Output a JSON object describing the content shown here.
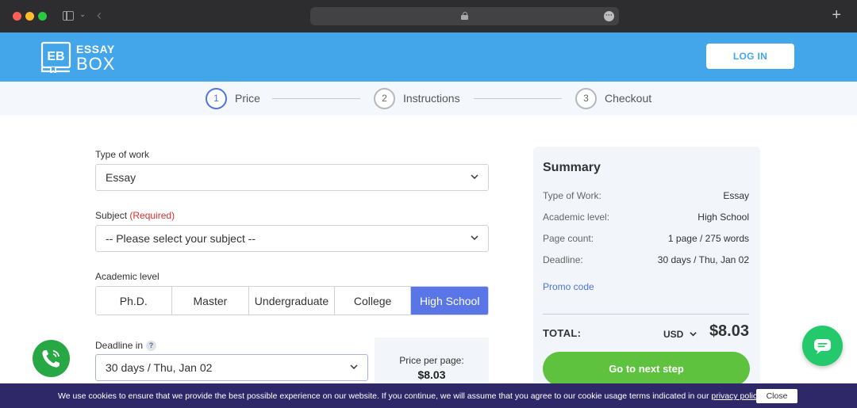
{
  "brand": {
    "logo_initials": "EB",
    "line1": "ESSAY",
    "line2": "BOX",
    "color": "#43a6ea"
  },
  "header": {
    "login_label": "LOG IN"
  },
  "stepper": [
    {
      "number": "1",
      "label": "Price",
      "active": true
    },
    {
      "number": "2",
      "label": "Instructions",
      "active": false
    },
    {
      "number": "3",
      "label": "Checkout",
      "active": false
    }
  ],
  "form": {
    "type_of_work": {
      "label": "Type of work",
      "value": "Essay"
    },
    "subject": {
      "label": "Subject",
      "required": "(Required)",
      "value": "-- Please select your subject --"
    },
    "academic_level": {
      "label": "Academic level",
      "options": [
        "Ph.D.",
        "Master",
        "Undergraduate",
        "College",
        "High School"
      ],
      "selected": "High School"
    },
    "deadline": {
      "label": "Deadline in",
      "help": "?",
      "value": "30 days / Thu, Jan 02"
    },
    "price_per_page": {
      "label": "Price per page:",
      "value": "$8.03"
    }
  },
  "summary": {
    "title": "Summary",
    "rows": [
      {
        "key": "Type of Work:",
        "value": "Essay"
      },
      {
        "key": "Academic level:",
        "value": "High School"
      },
      {
        "key": "Page count:",
        "value": "1 page / 275 words"
      },
      {
        "key": "Deadline:",
        "value": "30 days / Thu, Jan 02"
      }
    ],
    "promo_label": "Promo code",
    "total_label": "TOTAL:",
    "currency": "USD",
    "total_value": "$8.03",
    "next_label": "Go to next step"
  },
  "cookie": {
    "text": "We use cookies to ensure that we provide the best possible experience on our website. If you continue, we will assume that you agree to our cookie usage terms indicated in our ",
    "link": "privacy policy",
    "close_label": "Close"
  },
  "icons": {
    "phone": "phone-icon",
    "chat": "chat-icon",
    "lock": "lock-icon"
  },
  "colors": {
    "accent": "#5a76e6",
    "green": "#5ec23f",
    "cookie_bg": "#2f2868",
    "required": "#d6322f"
  }
}
